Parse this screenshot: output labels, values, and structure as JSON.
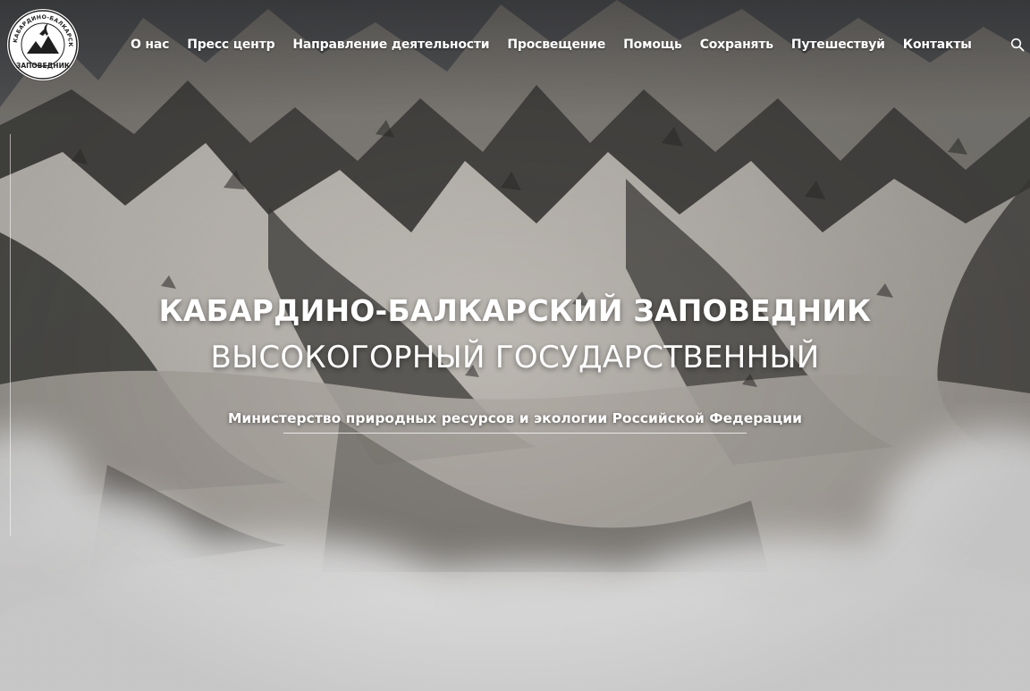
{
  "site": {
    "logo": {
      "name": "logo-badge",
      "ring_text": "КАБАРДИНО-БАЛКАРСКИЙ ВЫСОКОГОРНЫЙ",
      "bottom_text": "ЗАПОВЕДНИК"
    }
  },
  "nav": {
    "items": [
      {
        "label": "О нас"
      },
      {
        "label": "Пресс центр"
      },
      {
        "label": "Направление деятельности"
      },
      {
        "label": "Просвещение"
      },
      {
        "label": "Помощь"
      },
      {
        "label": "Сохранять"
      },
      {
        "label": "Путешествуй"
      },
      {
        "label": "Контакты"
      }
    ],
    "search_icon": "search-icon"
  },
  "hero": {
    "title_line1": "КАБАРДИНО-БАЛКАРСКИЙ ЗАПОВЕДНИК",
    "title_line2": "ВЫСОКОГОРНЫЙ ГОСУДАРСТВЕННЫЙ",
    "ministry": "Министерство природных ресурсов и экологии Российской Федерации",
    "background": "snowy-mountains-with-clouds"
  },
  "colors": {
    "text": "#ffffff",
    "mountain_dark": "#2e2d2b",
    "mountain_mid": "#6f6b66",
    "snow": "#e9e6e1",
    "cloud": "#ffffff"
  }
}
